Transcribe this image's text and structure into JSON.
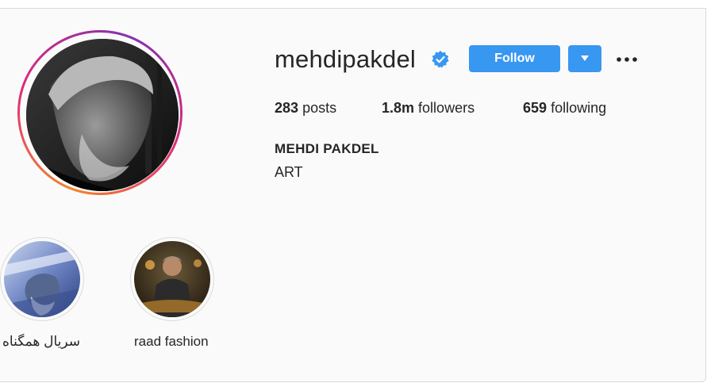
{
  "profile": {
    "username": "mehdipakdel",
    "verified": true,
    "follow_label": "Follow",
    "dropdown_icon": "triangle-down-icon",
    "more_icon": "ellipsis-icon",
    "accent_color": "#3897f0"
  },
  "stats": {
    "posts_count": "283",
    "posts_label": "posts",
    "followers_count": "1.8m",
    "followers_label": "followers",
    "following_count": "659",
    "following_label": "following"
  },
  "bio": {
    "full_name": "MEHDI PAKDEL",
    "text": "ART"
  },
  "highlights": [
    {
      "label": "سریال همگناه"
    },
    {
      "label": "raad fashion"
    }
  ]
}
